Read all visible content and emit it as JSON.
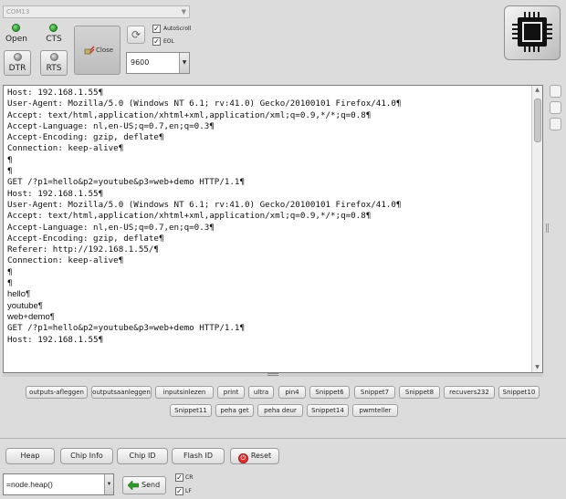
{
  "port": {
    "label": "COM13"
  },
  "indicators": {
    "open": "Open",
    "cts": "CTS",
    "dtr": "DTR",
    "rts": "RTS"
  },
  "close_label": "Close",
  "options": {
    "autoscroll": "AutoScroll",
    "eol": "EOL"
  },
  "baud": {
    "value": "9600"
  },
  "terminal": {
    "lines": [
      "Host: 192.168.1.55¶",
      "User-Agent: Mozilla/5.0 (Windows NT 6.1; rv:41.0) Gecko/20100101 Firefox/41.0¶",
      "Accept: text/html,application/xhtml+xml,application/xml;q=0.9,*/*;q=0.8¶",
      "Accept-Language: nl,en-US;q=0.7,en;q=0.3¶",
      "Accept-Encoding: gzip, deflate¶",
      "Connection: keep-alive¶",
      "¶",
      "¶",
      "GET /?p1=hello&p2=youtube&p3=web+demo HTTP/1.1¶",
      "Host: 192.168.1.55¶",
      "User-Agent: Mozilla/5.0 (Windows NT 6.1; rv:41.0) Gecko/20100101 Firefox/41.0¶",
      "Accept: text/html,application/xhtml+xml,application/xml;q=0.9,*/*;q=0.8¶",
      "Accept-Language: nl,en-US;q=0.7,en;q=0.3¶",
      "Accept-Encoding: gzip, deflate¶",
      "Referer: http://192.168.1.55/¶",
      "Connection: keep-alive¶",
      "¶",
      "¶",
      "hello¶",
      "youtube¶",
      "web+demo¶",
      "GET /?p1=hello&p2=youtube&p3=web+demo HTTP/1.1¶",
      "Host: 192.168.1.55¶"
    ]
  },
  "snippets": {
    "row1": [
      "outputs-afleggen",
      "outputsaanleggen",
      "inputsinlezen",
      "print",
      "ultra",
      "pin4",
      "Snippet6",
      "Snippet7",
      "Snippet8",
      "recuvers232",
      "Snippet10"
    ],
    "row2": [
      "Snippet11",
      "peha get",
      "peha deur",
      "Snippet14",
      "pwmteller"
    ]
  },
  "actions": {
    "heap": "Heap",
    "chip_info": "Chip Info",
    "chip_id": "Chip ID",
    "flash_id": "Flash ID",
    "reset": "Reset"
  },
  "command": {
    "value": "=node.heap()"
  },
  "send_label": "Send",
  "line_end": {
    "cr": "CR",
    "lf": "LF"
  }
}
